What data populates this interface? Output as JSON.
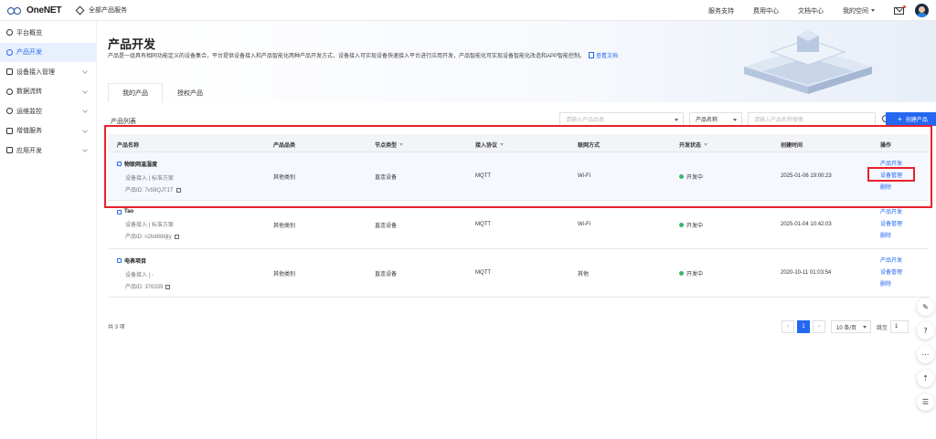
{
  "topbar": {
    "brand": "OneNET",
    "all_services": "全部产品服务",
    "nav": [
      "服务支持",
      "费用中心",
      "文档中心",
      "我的空间"
    ]
  },
  "sidebar": {
    "items": [
      {
        "label": "平台概览",
        "icon": "home-icon",
        "active": false
      },
      {
        "label": "产品开发",
        "icon": "product-icon",
        "active": true
      },
      {
        "label": "设备接入管理",
        "icon": "device-icon",
        "active": false
      },
      {
        "label": "数据流转",
        "icon": "dataflow-icon",
        "active": false
      },
      {
        "label": "运维监控",
        "icon": "monitor-icon",
        "active": false
      },
      {
        "label": "增值服务",
        "icon": "value-added-icon",
        "active": false
      },
      {
        "label": "应用开发",
        "icon": "app-dev-icon",
        "active": false
      }
    ]
  },
  "header": {
    "title": "产品开发",
    "description": "产品是一组具有相同功能定义的设备集合，平台提供设备接入和产品智能化两种产品开发方式，设备接入可实现设备快速接入平台进行应用开发，产品智能化可实现设备智能化改造和APP智能控制。",
    "doc_link": "查看文档"
  },
  "tabs": [
    "我的产品",
    "授权产品"
  ],
  "list": {
    "title": "产品列表",
    "filter_placeholder": "请输入产品品类",
    "sort_label": "产品名称",
    "search_placeholder": "请输入产品名称搜索",
    "create_button": "创建产品"
  },
  "table": {
    "columns": [
      "产品名称",
      "产品品类",
      "节点类型",
      "接入协议",
      "联网方式",
      "开发状态",
      "创建时间",
      "操作"
    ],
    "rows": [
      {
        "name": "物联网温湿度",
        "access": "设备接入",
        "scheme": "标准方案",
        "pid": "产品ID: 7v59QJT1T",
        "category": "其他类别",
        "node": "直连设备",
        "protocol": "MQTT",
        "network": "Wi-Fi",
        "status": "开发中",
        "created": "2025-01-06 19:00:23",
        "ops": [
          "产品开发",
          "设备管理",
          "删除"
        ]
      },
      {
        "name": "Tao",
        "access": "设备接入",
        "scheme": "标准方案",
        "pid": "产品ID: n2b8888jty",
        "category": "其他类别",
        "node": "直连设备",
        "protocol": "MQTT",
        "network": "Wi-Fi",
        "status": "开发中",
        "created": "2025-01-04 10:42:03",
        "ops": [
          "产品开发",
          "设备管理",
          "删除"
        ]
      },
      {
        "name": "电表项目",
        "access": "设备接入",
        "scheme": "-",
        "pid": "产品ID: 376339",
        "category": "其他类别",
        "node": "直连设备",
        "protocol": "MQTT",
        "network": "其他",
        "status": "开发中",
        "created": "2020-10-11 01:03:54",
        "ops": [
          "产品开发",
          "设备管理",
          "删除"
        ]
      }
    ]
  },
  "pagination": {
    "total": "共 3 项",
    "current": "1",
    "page_size": "10 条/页",
    "jump_label": "跳至",
    "jump_value": "1"
  },
  "colors": {
    "accent": "#2468f2",
    "highlight": "#e8212b",
    "status_ok": "#3cb371"
  }
}
